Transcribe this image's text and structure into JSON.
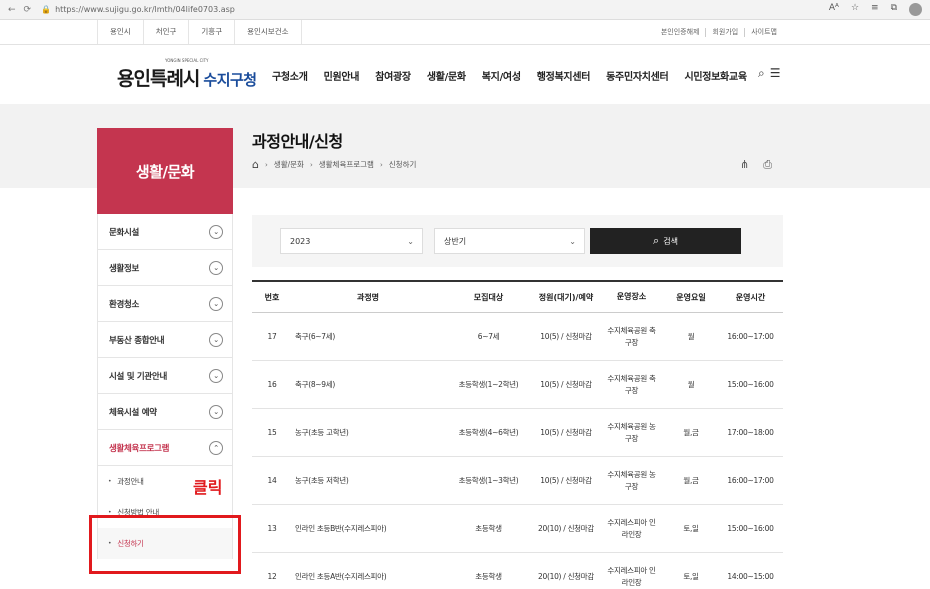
{
  "browser": {
    "url": "https://www.sujigu.go.kr/lmth/04life0703.asp",
    "back": "←",
    "refresh": "⟳",
    "lock": "🔒",
    "icons": [
      "Aᴬ",
      "☆",
      "≡",
      "⧉"
    ]
  },
  "util": {
    "sites": [
      "용인시",
      "처인구",
      "기흥구",
      "용인시보건소"
    ],
    "right": [
      "본인인증해제",
      "회원가입",
      "사이트맵"
    ]
  },
  "header": {
    "logo_main": "용인특례시",
    "logo_tiny": "YONGIN SPECIAL CITY",
    "logo_sub": "수지구청",
    "gnb": [
      "구청소개",
      "민원안내",
      "참여광장",
      "생활/문화",
      "복지/여성",
      "행정복지센터",
      "동주민자치센터",
      "시민정보화교육"
    ],
    "search_icon": "⌕",
    "menu_icon": "☰"
  },
  "sidebar": {
    "title": "생활/문화",
    "items": [
      {
        "label": "문화시설",
        "icon": "⌄"
      },
      {
        "label": "생활정보",
        "icon": "⌄"
      },
      {
        "label": "환경청소",
        "icon": "⌄"
      },
      {
        "label": "부동산 종합안내",
        "icon": "⌄"
      },
      {
        "label": "시설 및 기관안내",
        "icon": "⌄"
      },
      {
        "label": "체육시설 예약",
        "icon": "⌄"
      },
      {
        "label": "생활체육프로그램",
        "icon": "⌃"
      }
    ],
    "sub_items": [
      "과정안내",
      "신청방법 안내",
      "신청하기"
    ],
    "annotation": "클릭"
  },
  "content": {
    "title": "과정안내/신청",
    "breadcrumb": [
      "생활/문화",
      "생활체육프로그램",
      "신청하기"
    ],
    "share_icon": "⋔",
    "print_icon": "⎙",
    "year_select": "2023",
    "half_select": "상반기",
    "search_label": "검색",
    "search_icon": "⌕"
  },
  "table": {
    "headers": [
      "번호",
      "과정명",
      "모집대상",
      "정원(대기)/예약",
      "운영장소",
      "운영요일",
      "운영시간"
    ],
    "rows": [
      [
        "17",
        "축구(6~7세)",
        "6~7세",
        "10(5) / 신청마감",
        "수지체육공원 축구장",
        "월",
        "16:00~17:00"
      ],
      [
        "16",
        "축구(8~9세)",
        "초등학생(1~2학년)",
        "10(5) / 신청마감",
        "수지체육공원 축구장",
        "월",
        "15:00~16:00"
      ],
      [
        "15",
        "농구(초등 고학년)",
        "초등학생(4~6학년)",
        "10(5) / 신청마감",
        "수지체육공원 농구장",
        "월,금",
        "17:00~18:00"
      ],
      [
        "14",
        "농구(초등 저학년)",
        "초등학생(1~3학년)",
        "10(5) / 신청마감",
        "수지체육공원 농구장",
        "월,금",
        "16:00~17:00"
      ],
      [
        "13",
        "인라인 초등B반(수지레스피아)",
        "초등학생",
        "20(10) / 신청마감",
        "수지레스피아 인라인장",
        "토,일",
        "15:00~16:00"
      ],
      [
        "12",
        "인라인 초등A반(수지레스피아)",
        "초등학생",
        "20(10) / 신청마감",
        "수지레스피아 인라인장",
        "토,일",
        "14:00~15:00"
      ]
    ]
  },
  "colors": {
    "accent": "#c4354f",
    "annotation": "#e1191d",
    "button": "#222222"
  }
}
